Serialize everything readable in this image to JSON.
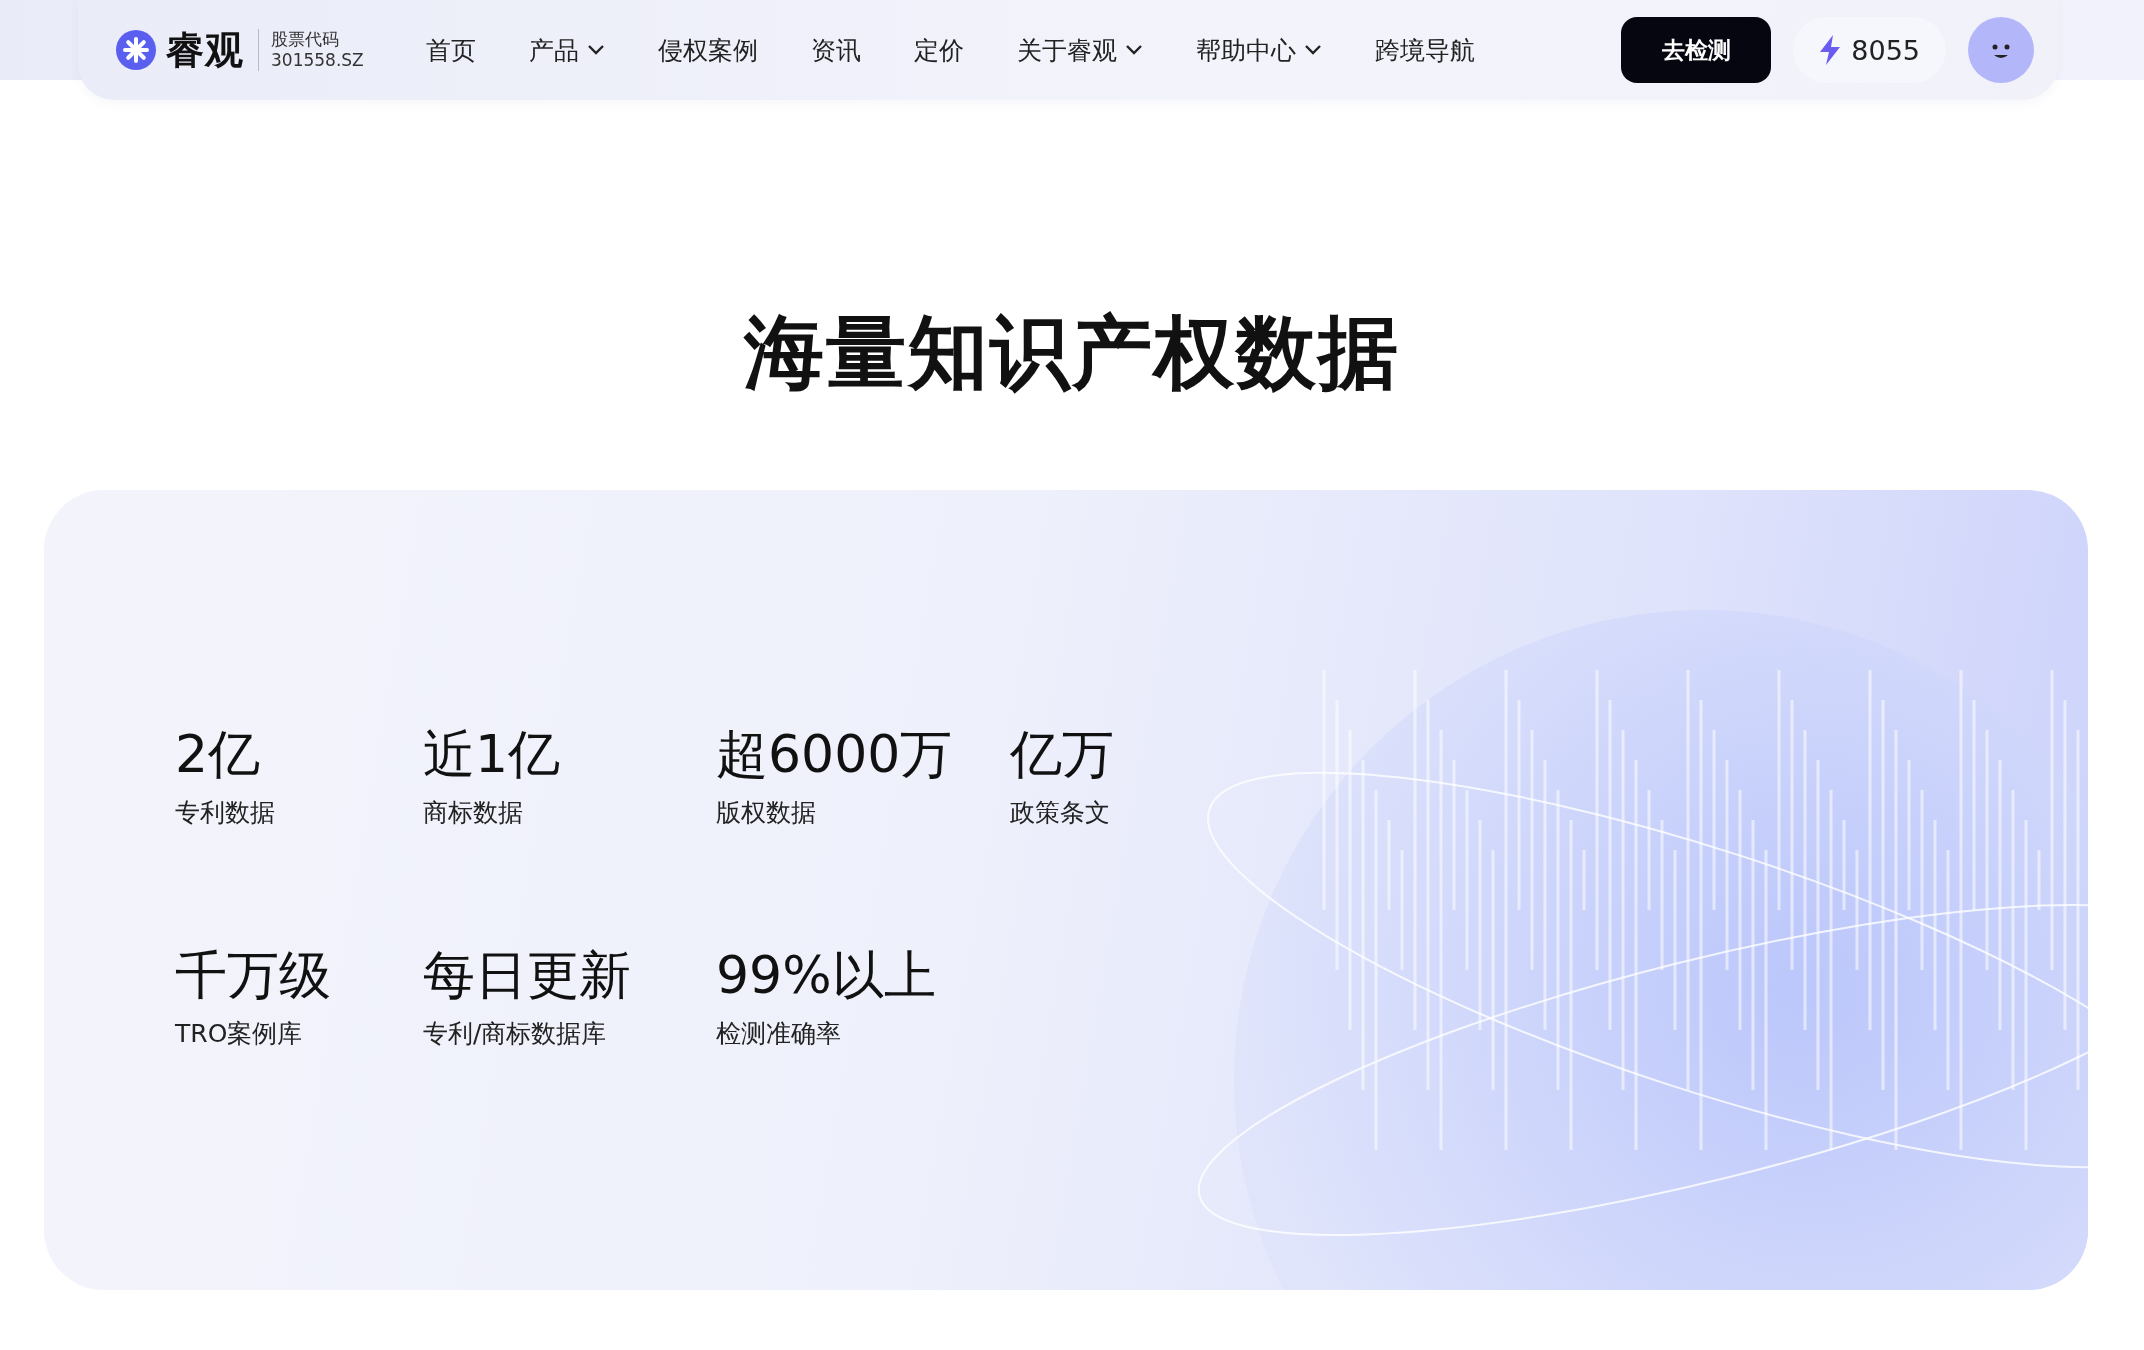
{
  "header": {
    "brand": "睿观",
    "stock_label": "股票代码",
    "stock_code": "301558.SZ",
    "nav": [
      {
        "label": "首页",
        "has_menu": false
      },
      {
        "label": "产品",
        "has_menu": true
      },
      {
        "label": "侵权案例",
        "has_menu": false
      },
      {
        "label": "资讯",
        "has_menu": false
      },
      {
        "label": "定价",
        "has_menu": false
      },
      {
        "label": "关于睿观",
        "has_menu": true
      },
      {
        "label": "帮助中心",
        "has_menu": true
      },
      {
        "label": "跨境导航",
        "has_menu": false
      }
    ],
    "cta": "去检测",
    "points": "8055"
  },
  "section": {
    "title": "海量知识产权数据",
    "stats": [
      [
        {
          "value": "2亿",
          "label": "专利数据"
        },
        {
          "value": "近1亿",
          "label": "商标数据"
        },
        {
          "value": "超6000万",
          "label": "版权数据"
        },
        {
          "value": "亿万",
          "label": "政策条文"
        }
      ],
      [
        {
          "value": "千万级",
          "label": "TRO案例库"
        },
        {
          "value": "每日更新",
          "label": "专利/商标数据库"
        },
        {
          "value": "99%以上",
          "label": "检测准确率"
        }
      ]
    ]
  }
}
